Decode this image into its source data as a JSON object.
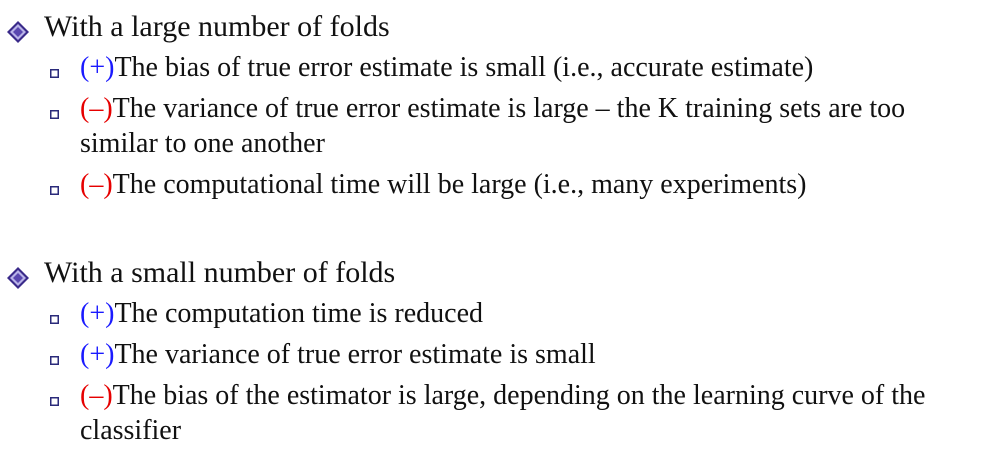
{
  "section1": {
    "heading": "With a large number of folds",
    "items": [
      {
        "sign": "(+)",
        "sign_type": "plus",
        "text": "The bias of true error estimate is small (i.e., accurate estimate)"
      },
      {
        "sign": "(–)",
        "sign_type": "minus",
        "text": "The variance of true error estimate is large – the K training sets are too similar to one another"
      },
      {
        "sign": "(–)",
        "sign_type": "minus",
        "text": "The computational time will be large (i.e., many experiments)"
      }
    ]
  },
  "section2": {
    "heading": "With a small number of folds",
    "items": [
      {
        "sign": "(+)",
        "sign_type": "plus",
        "text": "The computation time is reduced"
      },
      {
        "sign": "(+)",
        "sign_type": "plus",
        "text": "The variance of true error estimate is small"
      },
      {
        "sign": "(–)",
        "sign_type": "minus",
        "text": "The bias of the estimator is large, depending on the learning curve of the classifier"
      }
    ]
  },
  "colors": {
    "plus": "#1a1aff",
    "minus": "#e60000",
    "bullet_diamond": "#3a2a8a",
    "bullet_square": "#2a2a7a"
  },
  "icons": {
    "main_bullet": "diamond-icon",
    "sub_bullet": "square-icon"
  }
}
